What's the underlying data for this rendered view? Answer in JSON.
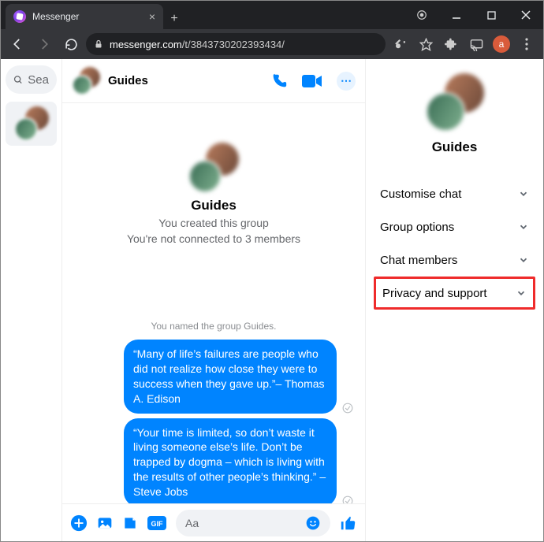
{
  "browser": {
    "tab_title": "Messenger",
    "url_host": "messenger.com",
    "url_path": "/t/3843730202393434/",
    "profile_letter": "a"
  },
  "sidebar": {
    "search_placeholder": "Sea"
  },
  "chat": {
    "title": "Guides",
    "intro_title": "Guides",
    "intro_line1": "You created this group",
    "intro_line2": "You're not connected to 3 members",
    "system_message": "You named the group Guides.",
    "messages": [
      "“Many of life’s failures are people who did not realize how close they were to success when they gave up.”– Thomas A. Edison",
      "“Your time is limited, so don’t waste it living someone else’s life. Don’t be trapped by dogma – which is living with the results of other people’s thinking.” – Steve Jobs"
    ],
    "composer_placeholder": "Aa"
  },
  "details": {
    "title": "Guides",
    "sections": [
      "Customise chat",
      "Group options",
      "Chat members",
      "Privacy and support"
    ],
    "highlight_index": 3
  }
}
